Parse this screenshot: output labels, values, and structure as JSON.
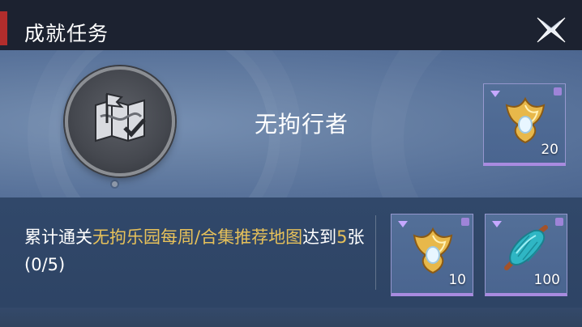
{
  "header": {
    "title": "成就任务",
    "close_icon": "close-x-icon"
  },
  "achievement": {
    "name": "无拘行者",
    "badge_icon": "map-flag-badge-icon",
    "reward": {
      "icon": "golden-lotus-crest-icon",
      "count": "20"
    }
  },
  "task": {
    "prefix": "累计通关",
    "highlight1": "无拘乐园每周/合集推荐地图",
    "mid": "达到",
    "highlight2": "5",
    "suffix": "张 (0/5)",
    "rewards": [
      {
        "icon": "golden-lotus-crest-icon",
        "count": "10"
      },
      {
        "icon": "teal-cocoon-item-icon",
        "count": "100"
      }
    ]
  },
  "colors": {
    "header_bg": "#1c2230",
    "accent_red": "#b12d2c",
    "highlight_gold": "#e7c15a",
    "rarity_purple": "#a98be0"
  }
}
